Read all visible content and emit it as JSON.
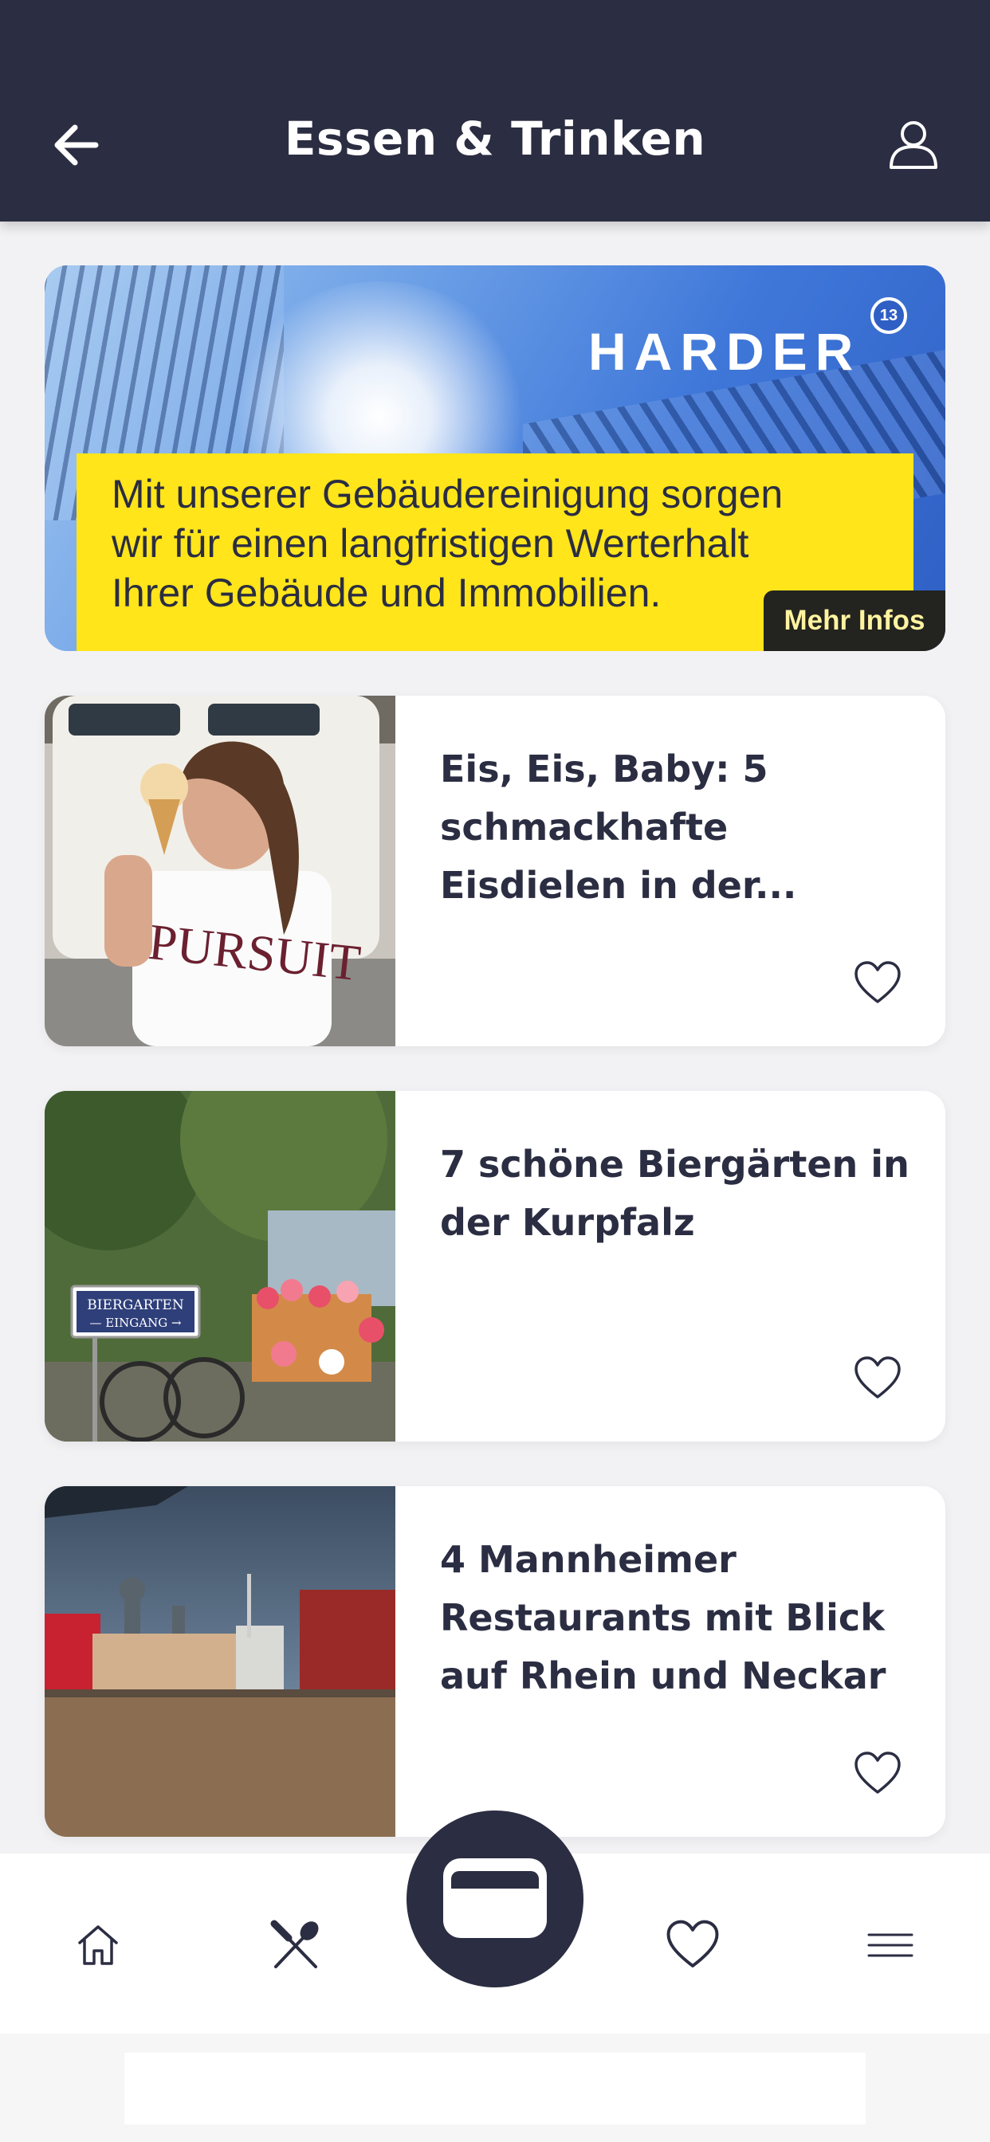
{
  "header": {
    "title": "Essen & Trinken",
    "back_icon": "arrow-left-icon",
    "profile_icon": "user-icon",
    "background": "#2b2d42"
  },
  "ad": {
    "brand": "HARDER",
    "brand_badge": "13",
    "lines": [
      "Mit unserer Gebäudereinigung sorgen",
      "wir für einen langfristigen Werterhalt",
      "Ihrer Gebäude und Immobilien."
    ],
    "cta": "Mehr Infos",
    "highlight_color": "#ffe51a"
  },
  "articles": [
    {
      "title": "Eis, Eis, Baby: 5 schmackhafte Eisdielen in der...",
      "shirt_text": "PURSUIT",
      "fav_icon": "heart-icon"
    },
    {
      "title": "7 schöne Biergärten in der Kurpfalz",
      "sign_line1": "BIERGARTEN",
      "sign_line2": "— EINGANG →",
      "fav_icon": "heart-icon"
    },
    {
      "title": "4 Mannheimer Restaurants mit Blick auf Rhein und Neckar",
      "fav_icon": "heart-icon"
    }
  ],
  "bottom_nav": {
    "items": [
      "home-icon",
      "restaurant-icon",
      "wallet-icon",
      "heart-icon",
      "menu-icon"
    ],
    "accent": "#2b2d42"
  }
}
